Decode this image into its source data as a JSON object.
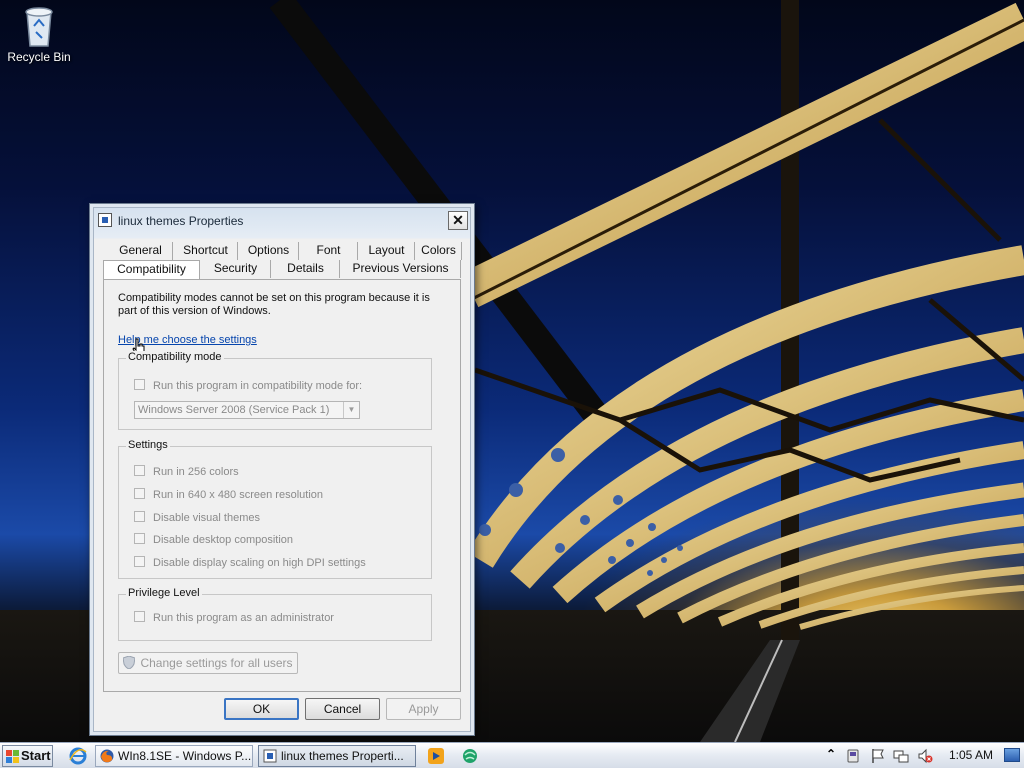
{
  "desktop": {
    "icons": [
      {
        "label": "Recycle Bin",
        "icon": "recycle-bin-icon"
      }
    ]
  },
  "dialog": {
    "title": "linux themes Properties",
    "close_symbol": "✕",
    "tabs_row1": [
      "General",
      "Shortcut",
      "Options",
      "Font",
      "Layout",
      "Colors"
    ],
    "tabs_row2": [
      "Compatibility",
      "Security",
      "Details",
      "Previous Versions"
    ],
    "active_tab": "Compatibility",
    "info_text": "Compatibility modes cannot be set on this program because it is part of this version of Windows.",
    "help_link": "Help me choose the settings",
    "compat_group": {
      "label": "Compatibility mode",
      "checkbox": "Run this program in compatibility mode for:",
      "dropdown_value": "Windows Server 2008 (Service Pack 1)"
    },
    "settings_group": {
      "label": "Settings",
      "options": [
        "Run in 256 colors",
        "Run in 640 x 480 screen resolution",
        "Disable visual themes",
        "Disable desktop composition",
        "Disable display scaling on high DPI settings"
      ]
    },
    "privilege_group": {
      "label": "Privilege Level",
      "checkbox": "Run this program as an administrator"
    },
    "change_all_users_button": "Change settings for all users",
    "buttons": {
      "ok": "OK",
      "cancel": "Cancel",
      "apply": "Apply"
    }
  },
  "taskbar": {
    "start_label": "Start",
    "tasks": [
      {
        "label": "WIn8.1SE - Windows P...",
        "icon": "firefox-icon",
        "active": false
      },
      {
        "label": "linux themes Properti...",
        "icon": "properties-icon",
        "active": true
      }
    ],
    "clock": "1:05 AM"
  },
  "colors": {
    "link": "#0645ad",
    "disabled_text": "#8a8a8a",
    "default_button_border": "#3a75c4"
  }
}
